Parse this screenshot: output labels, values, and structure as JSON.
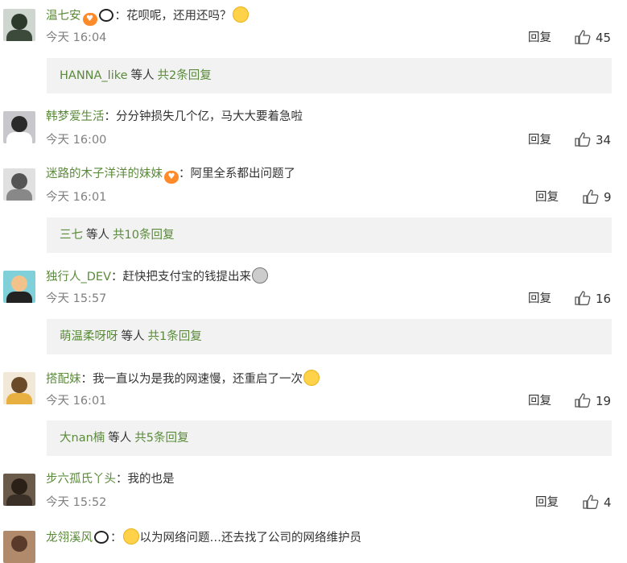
{
  "colors": {
    "username": "#5a8a3a",
    "time": "#808080",
    "reply_box": "#f2f2f2",
    "text": "#333333"
  },
  "labels": {
    "reply": "回复",
    "like_icon": "thumbs-up-icon"
  },
  "comments": [
    {
      "user": "温七安",
      "text": "花呗呢，还用还吗？",
      "time": "今天 16:04",
      "likes": "45",
      "subreply": {
        "name": "HANNA_like",
        "mid": "等人",
        "total": "共2条回复"
      }
    },
    {
      "user": "韩梦爱生活",
      "text": "分分钟损失几个亿，马大大要着急啦",
      "time": "今天 16:00",
      "likes": "34"
    },
    {
      "user": "迷路的木子洋洋的妹妹",
      "text": "阿里全系都出问题了",
      "time": "今天 16:01",
      "likes": "9",
      "subreply": {
        "name": "三七",
        "mid": "等人",
        "total": "共10条回复"
      }
    },
    {
      "user": "独行人_DEV",
      "text": "赶快把支付宝的钱提出来",
      "time": "今天 15:57",
      "likes": "16",
      "subreply": {
        "name": "萌温柔呀呀",
        "mid": "等人",
        "total": "共1条回复"
      }
    },
    {
      "user": "搭配妹",
      "text": "我一直以为是我的网速慢，还重启了一次",
      "time": "今天 16:01",
      "likes": "19",
      "subreply": {
        "name": "大nan楠",
        "mid": "等人",
        "total": "共5条回复"
      }
    },
    {
      "user": "步六孤氏丫头",
      "text": "我的也是",
      "time": "今天 15:52",
      "likes": "4"
    },
    {
      "user": "龙翎溪风",
      "text": "以为网络问题…还去找了公司的网络维护员"
    }
  ]
}
